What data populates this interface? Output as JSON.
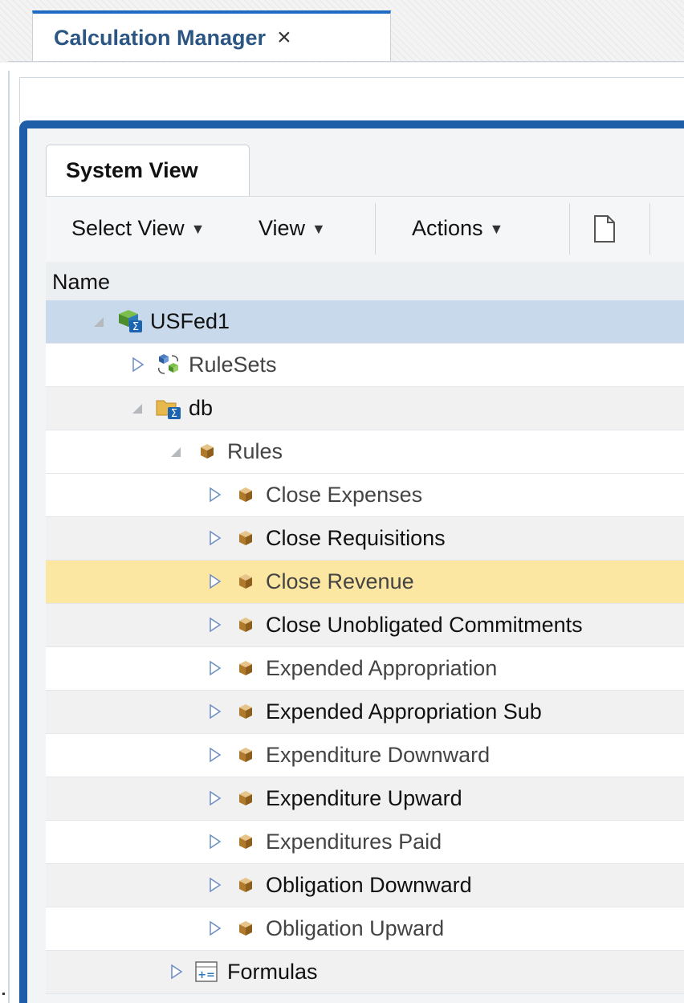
{
  "window": {
    "tab_title": "Calculation Manager",
    "tab_close": "×"
  },
  "panel": {
    "tab_label": "System View",
    "toolbar": {
      "select_view": "Select View",
      "view": "View",
      "actions": "Actions",
      "dropdown_glyph": "▼"
    },
    "column_header": "Name"
  },
  "colors": {
    "accent_blue": "#1e5ea8",
    "tab_title_blue": "#2b5582",
    "selected_row": "#c7d9eb",
    "hover_row": "#fbe6a2",
    "alt_row": "#f1f1f1"
  },
  "tree": [
    {
      "label": "USFed1",
      "icon": "application-icon",
      "expanded": true,
      "state": "selected"
    },
    {
      "label": "RuleSets",
      "icon": "rulesets-icon",
      "expanded": false,
      "state": "normal"
    },
    {
      "label": "db",
      "icon": "database-folder-icon",
      "expanded": true,
      "state": "alt"
    },
    {
      "label": "Rules",
      "icon": "rule-cube-icon",
      "expanded": true,
      "state": "normal"
    },
    {
      "label": "Close Expenses",
      "icon": "rule-cube-icon",
      "expanded": false,
      "state": "normal"
    },
    {
      "label": "Close Requisitions",
      "icon": "rule-cube-icon",
      "expanded": false,
      "state": "alt"
    },
    {
      "label": "Close Revenue",
      "icon": "rule-cube-icon",
      "expanded": false,
      "state": "hover"
    },
    {
      "label": "Close Unobligated Commitments",
      "icon": "rule-cube-icon",
      "expanded": false,
      "state": "alt"
    },
    {
      "label": "Expended Appropriation",
      "icon": "rule-cube-icon",
      "expanded": false,
      "state": "normal"
    },
    {
      "label": "Expended Appropriation Sub",
      "icon": "rule-cube-icon",
      "expanded": false,
      "state": "alt"
    },
    {
      "label": "Expenditure Downward",
      "icon": "rule-cube-icon",
      "expanded": false,
      "state": "normal"
    },
    {
      "label": "Expenditure Upward",
      "icon": "rule-cube-icon",
      "expanded": false,
      "state": "alt"
    },
    {
      "label": "Expenditures Paid",
      "icon": "rule-cube-icon",
      "expanded": false,
      "state": "normal"
    },
    {
      "label": "Obligation Downward",
      "icon": "rule-cube-icon",
      "expanded": false,
      "state": "alt"
    },
    {
      "label": "Obligation Upward",
      "icon": "rule-cube-icon",
      "expanded": false,
      "state": "normal"
    },
    {
      "label": "Formulas",
      "icon": "formulas-icon",
      "expanded": false,
      "state": "alt"
    }
  ]
}
